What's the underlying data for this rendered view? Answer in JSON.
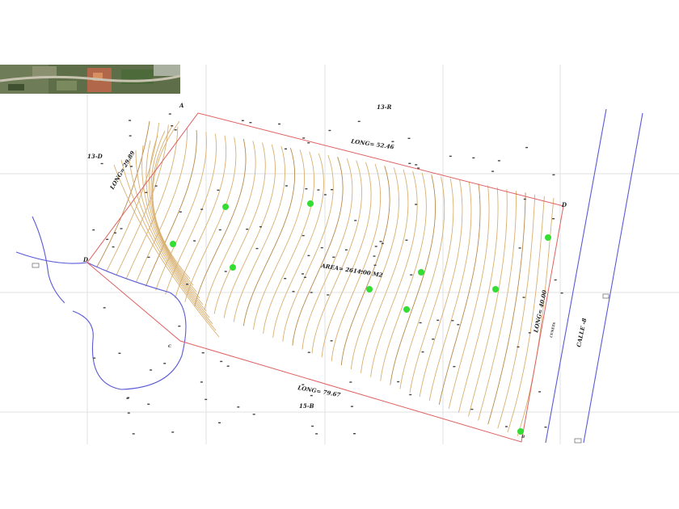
{
  "plan": {
    "labels": {
      "lot_13r": "13-R",
      "lot_13d": "13-D",
      "lot_15b": "15-B",
      "long_north": "LONG= 52.46",
      "long_west": "LONG= 29.89",
      "long_south": "LONG= 79.67",
      "long_east": "LONG= 40.00",
      "area": "AREA= 2614.00 M2",
      "street": "CALLE  -8",
      "curb": "CUNETA",
      "vertex_a": "A",
      "vertex_b": "B",
      "vertex_c": "C",
      "vertex_d": "D"
    },
    "colors": {
      "boundary": "#e06060",
      "contour": "#d8b070",
      "contour_alt": "#b88a4a",
      "road": "#5a5ad8",
      "grid": "#e2e2e2",
      "tree": "#33dd33",
      "survey_point": "#444444"
    },
    "trees_count": 10
  },
  "aerial_photo": {
    "description_icon": "aerial-photo-thumbnail"
  }
}
